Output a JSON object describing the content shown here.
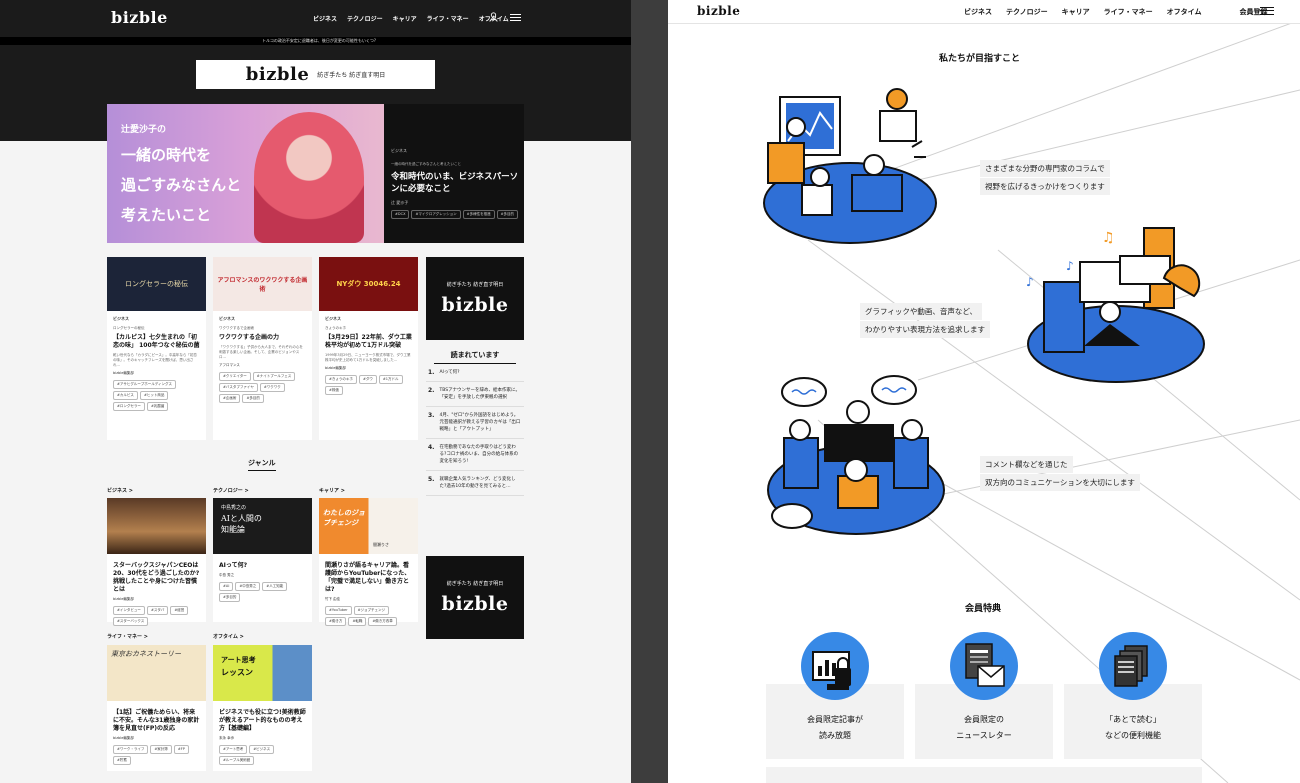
{
  "left_page": {
    "logo": "bizble",
    "nav": [
      "ビジネス",
      "テクノロジー",
      "キャリア",
      "ライフ・マネー",
      "オフタイム"
    ],
    "ticker": "トルコの政治不安定に退職者は、後日が変更の可能性もいくつ?",
    "banner": {
      "logo": "bizble",
      "tagline": "紡ぎ手たち 紡ぎ直す明日"
    },
    "hero": {
      "name": "辻愛沙子の",
      "line1": "一緒の時代を",
      "line2": "過ごすみなさんと",
      "line3": "考えたいこと",
      "category": "ビジネス",
      "series": "一緒の時代を過ごすみなさんと考えたいこと",
      "title": "令和時代のいま、ビジネスパーソンに必要なこと",
      "author": "辻 愛沙子",
      "tags": [
        "#DCX",
        "#マイクロアグレッション",
        "#多様性を推進",
        "#多目的"
      ]
    },
    "cards": [
      {
        "thumb": "ロングセラーの秘伝",
        "category": "ビジネス",
        "series": "ロングセラーの秘伝",
        "title": "【カルピス】七夕生まれの「初恋の味」 100年つなぐ秘伝の菌",
        "desc": "乾い世代なら「カラダにピース」。中高年なら「初恋の味」。そのキャッチフレーズを聞けば、思い出され…",
        "author": "bizble編集部",
        "tags": [
          "#アサヒグループホールディングス",
          "#カルピス",
          "#ヒット商品",
          "#ロングセラー",
          "#乳酸菌"
        ]
      },
      {
        "thumb": "アフロマンスのワクワクする企画術",
        "category": "ビジネス",
        "series": "ワクワクするで企画術",
        "title": "ワクワクする企画の力",
        "desc": "「ワクワクする」子供から大人まで、それぞれの心を刺激する楽しい企画。そして、企業のビジョンやスロ…",
        "author": "アフロマンス",
        "tags": [
          "#クリエイター",
          "#ナイトプールフェス",
          "#バスタブファイヤ",
          "#ワクワク",
          "#企画術",
          "#多目的"
        ]
      },
      {
        "thumb": "NYダウ 30046.24",
        "category": "ビジネス",
        "series": "きょうのキホ",
        "title": "【3月29日】22年前、ダウ工業株平均が初めて1万ドル突破",
        "desc": "1999年3月29日、ニューヨーク株式市場で、ダウ工業株平均が史上初めて1万ドルを突破しました…",
        "author": "bizble編集部",
        "tags": [
          "#きょうのキホ",
          "#ダウ",
          "#1万ドル",
          "#株価"
        ]
      }
    ],
    "ad": {
      "tagline": "紡ぎ手たち 紡ぎ直す明日",
      "logo": "bizble"
    },
    "ranking": {
      "title": "読まれています",
      "items": [
        {
          "n": "1.",
          "t": "AIって何?"
        },
        {
          "n": "2.",
          "t": "TBSアナウンサーを辞め、絵本作家に。「安定」を手放した伊東楓の選択"
        },
        {
          "n": "3.",
          "t": "4月、\"ゼロ\"から外国語をはじめよう。元芸能通訳が教える学習のカギは「出口戦略」と「アウトプット」"
        },
        {
          "n": "4.",
          "t": "在宅勤務であなたの手取りはどう変わる?コロナ禍のいま、自分の給与体系の変化を知ろう!"
        },
        {
          "n": "5.",
          "t": "就職企業人気ランキング、どう変化した?過去10年の動きを見てみると…"
        }
      ]
    },
    "genre_title": "ジャンル",
    "genres": [
      {
        "label": "ビジネス >",
        "title": "スターバックスジャパンCEOは20、30代をどう過ごしたのか?挑戦したことや身につけた習慣とは",
        "author": "bizble編集部",
        "tags": [
          "#インタビュー",
          "#スタバ",
          "#経営",
          "#スターバックス"
        ]
      },
      {
        "label": "テクノロジー >",
        "title": "AIって何?",
        "author": "中島 秀之",
        "tags": [
          "#AI",
          "#中島秀之",
          "#人工知能",
          "#多目的"
        ]
      },
      {
        "label": "キャリア >",
        "title": "間瀬りさが語るキャリア論。看護師からYouTuberになった、「完璧で満足しない」働き方とは?",
        "author": "竹下 由佳",
        "tags": [
          "#YouTuber",
          "#ジョブチェンジ",
          "#働き方",
          "#転職",
          "#働き方改革"
        ]
      },
      {
        "label": "ライフ・マネー >",
        "title": "【1話】ご祝儀ためらい、将来に不安。そんな31歳独身の家計簿を見直せ(FP)の反応",
        "author": "bizble編集部",
        "tags": [
          "#ワーク・ライフ",
          "#家計簿",
          "#FP",
          "#貯蓄"
        ]
      },
      {
        "label": "オフタイム >",
        "title": "ビジネスでも役に立つ!美術教師が教えるアート的なものの考え方【基礎編】",
        "author": "末永 幸歩",
        "tags": [
          "#アート思考",
          "#ビジネス",
          "#ルーブル美術館"
        ]
      }
    ],
    "thumb_texts": {
      "career": "わたしのジョブチェンジ",
      "career_name": "間瀬りさ",
      "life": "東京おカネストーリー",
      "off1": "アート思考",
      "off2": "レッスン",
      "tech1": "中島秀之の",
      "tech2": "AIと人間の",
      "tech3": "知能論"
    }
  },
  "right_page": {
    "logo": "bizble",
    "nav": [
      "ビジネス",
      "テクノロジー",
      "キャリア",
      "ライフ・マネー",
      "オフタイム"
    ],
    "register": "会員登録",
    "mission_title": "私たちが目指すこと",
    "caption1": [
      "さまざまな分野の専門家のコラムで",
      "視野を広げるきっかけをつくります"
    ],
    "caption2": [
      "グラフィックや動画、音声など、",
      "わかりやすい表現方法を追求します"
    ],
    "caption3": [
      "コメント欄などを通じた",
      "双方向のコミュニケーションを大切にします"
    ],
    "benefits_title": "会員特典",
    "benefits": [
      {
        "line1": "会員限定記事が",
        "line2": "読み放題",
        "icon": "chart-lock-icon"
      },
      {
        "line1": "会員限定の",
        "line2": "ニュースレター",
        "icon": "newsletter-icon"
      },
      {
        "line1": "「あとで読む」",
        "line2": "などの便利機能",
        "icon": "documents-icon"
      }
    ],
    "accent_color": "#2f6fd6"
  }
}
